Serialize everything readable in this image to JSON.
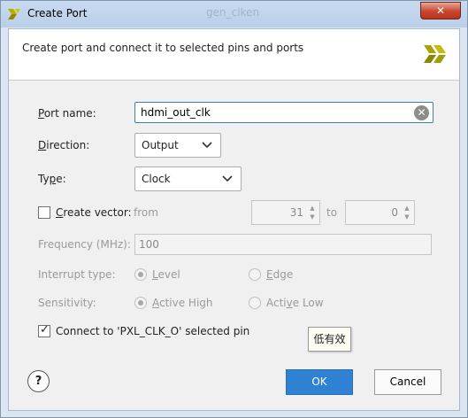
{
  "window": {
    "title": "Create Port",
    "background_tab_text": "gen_clken",
    "close_label": "✕"
  },
  "header": {
    "description": "Create port and connect it to selected pins and ports"
  },
  "form": {
    "port_name": {
      "label_prefix": "P",
      "label_rest": "ort name:",
      "value": "hdmi_out_clk"
    },
    "direction": {
      "label_prefix": "D",
      "label_rest": "irection:",
      "value": "Output"
    },
    "type": {
      "label_prefix": "Ty",
      "label_underline": "p",
      "label_rest": "e:",
      "value": "Clock"
    },
    "create_vector": {
      "label_underline": "C",
      "label_rest": "reate vector:",
      "checked": false,
      "from_label": "from",
      "from_value": "31",
      "to_label": "to",
      "to_value": "0"
    },
    "frequency": {
      "label": "Frequency (MHz):",
      "value": "100"
    },
    "interrupt_type": {
      "label": "Interrupt type:",
      "option1_underline": "L",
      "option1_rest": "evel",
      "option2_underline": "E",
      "option2_rest": "dge",
      "selected": "Level"
    },
    "sensitivity": {
      "label": "Sensitivity:",
      "option1_underline": "A",
      "option1_rest": "ctive High",
      "option2_prefix": "Acti",
      "option2_underline": "v",
      "option2_rest": "e Low",
      "selected": "Active High"
    },
    "connect": {
      "label": "Connect to 'PXL_CLK_O' selected  pin",
      "checked": true
    }
  },
  "tooltip": {
    "text": "低有效"
  },
  "footer": {
    "help_label": "?",
    "ok_label": "OK",
    "cancel_label": "Cancel"
  },
  "colors": {
    "accent": "#2f81d3",
    "titlebar": "#c8daf0",
    "close": "#c9452d"
  }
}
